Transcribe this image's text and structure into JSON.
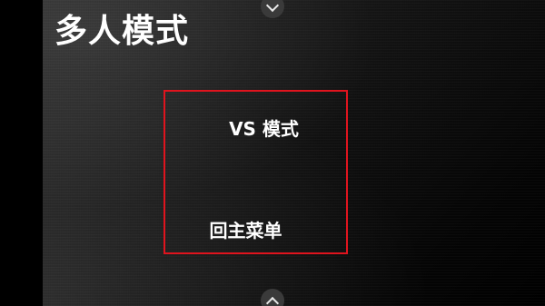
{
  "screen": {
    "title": "多人模式"
  },
  "menu": {
    "items": [
      {
        "label": "VS 模式"
      },
      {
        "label": "回主菜单"
      }
    ],
    "highlight_color": "#e0141e"
  },
  "nav": {
    "scroll_up_icon": "chevron-down-icon",
    "scroll_down_icon": "chevron-up-icon"
  }
}
